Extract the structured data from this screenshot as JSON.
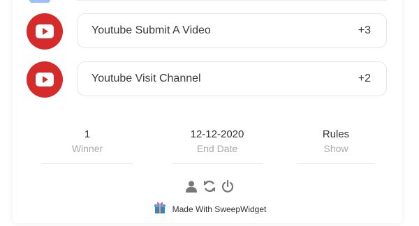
{
  "entries": [
    {
      "label": "Youtube Submit A Video",
      "points": "+3"
    },
    {
      "label": "Youtube Visit Channel",
      "points": "+2"
    }
  ],
  "stats": [
    {
      "value": "1",
      "label": "Winner"
    },
    {
      "value": "12-12-2020",
      "label": "End Date"
    },
    {
      "value": "Rules",
      "label": "Show"
    }
  ],
  "footer": {
    "icons": [
      "user-icon",
      "refresh-icon",
      "power-icon"
    ],
    "made_with": "Made With SweepWidget"
  },
  "colors": {
    "youtube_red": "#d62b2b",
    "icon_gray": "#777777"
  }
}
